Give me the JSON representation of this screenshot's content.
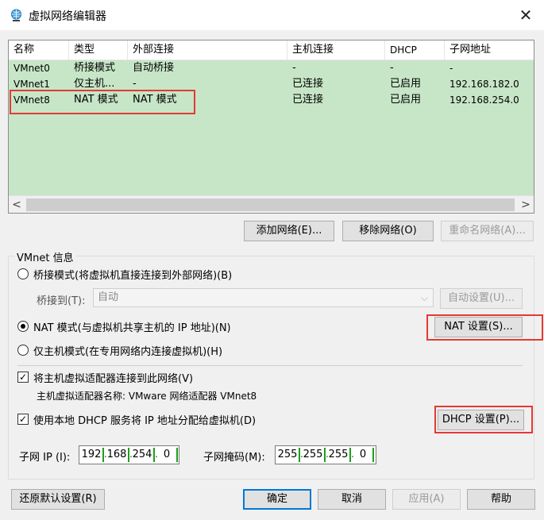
{
  "window": {
    "title": "虚拟网络编辑器",
    "close_glyph": "✕"
  },
  "table": {
    "headers": [
      "名称",
      "类型",
      "外部连接",
      "主机连接",
      "DHCP",
      "子网地址"
    ],
    "rows": [
      {
        "name": "VMnet0",
        "type": "桥接模式",
        "external": "自动桥接",
        "host": "-",
        "dhcp": "-",
        "subnet": "-"
      },
      {
        "name": "VMnet1",
        "type": "仅主机...",
        "external": "-",
        "host": "已连接",
        "dhcp": "已启用",
        "subnet": "192.168.182.0"
      },
      {
        "name": "VMnet8",
        "type": "NAT 模式",
        "external": "NAT 模式",
        "host": "已连接",
        "dhcp": "已启用",
        "subnet": "192.168.254.0"
      }
    ],
    "scroll_left": "<",
    "scroll_right": ">"
  },
  "list_buttons": {
    "add": "添加网络(E)...",
    "remove": "移除网络(O)",
    "rename": "重命名网络(A)..."
  },
  "vmnet_info": {
    "group_label": "VMnet 信息",
    "bridge_radio": "桥接模式(将虚拟机直接连接到外部网络)(B)",
    "bridge_to_label": "桥接到(T):",
    "bridge_to_value": "自动",
    "auto_settings": "自动设置(U)...",
    "nat_radio": "NAT 模式(与虚拟机共享主机的 IP 地址)(N)",
    "nat_settings": "NAT 设置(S)...",
    "hostonly_radio": "仅主机模式(在专用网络内连接虚拟机)(H)",
    "connect_adapter": "将主机虚拟适配器连接到此网络(V)",
    "adapter_name": "主机虚拟适配器名称: VMware 网络适配器 VMnet8",
    "dhcp_check": "使用本地 DHCP 服务将 IP 地址分配给虚拟机(D)",
    "dhcp_settings": "DHCP 设置(P)...",
    "subnet_ip_label": "子网 IP (I):",
    "subnet_ip": [
      "192",
      "168",
      "254",
      "0"
    ],
    "subnet_mask_label": "子网掩码(M):",
    "subnet_mask": [
      "255",
      "255",
      "255",
      "0"
    ]
  },
  "footer": {
    "restore": "还原默认设置(R)",
    "ok": "确定",
    "cancel": "取消",
    "apply": "应用(A)",
    "help": "帮助"
  },
  "colors": {
    "selected_row": "#c7e6c7",
    "highlight": "#e53935",
    "focus": "#0078d7"
  }
}
